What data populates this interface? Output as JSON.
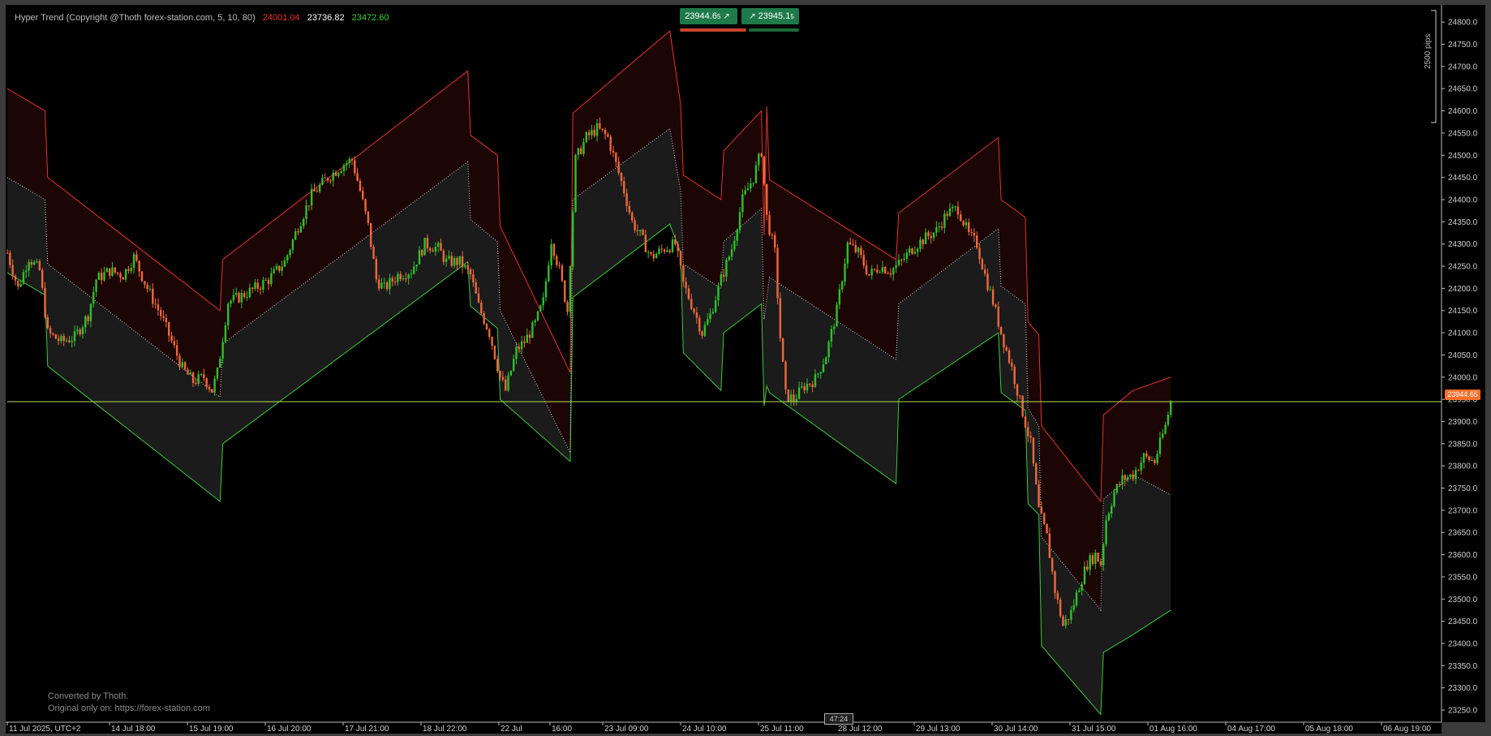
{
  "header": {
    "indicator_name": "Hyper Trend (Copyright @Thoth forex-station.com, 5, 10, 80)",
    "value_upper": "24001.04",
    "value_mid": "23736.82",
    "value_lower": "23472.60",
    "color_upper": "#e8342a",
    "color_mid": "#ffffff",
    "color_lower": "#39d42f"
  },
  "trade_panel": {
    "sell_price": "23944.6",
    "sell_suffix": "5",
    "buy_price": "23945.1",
    "buy_suffix": "5"
  },
  "watermark": {
    "line1": "Converted by Thoth.",
    "line2": "Original only on: https://forex-station.com"
  },
  "current_price_label": "23944.65",
  "bar_timer": "47:24",
  "pips_label": "2500 pips",
  "colors": {
    "background": "#000000",
    "upper_band": "#e2352a",
    "lower_band": "#3cc93a",
    "mid_dots": "#cccccc",
    "upper_fill": "#1c0505",
    "lower_fill": "#1b1b1b",
    "bull_candle": "#2fc12c",
    "bear_candle": "#f0683c",
    "price_line": "#b7e05a"
  },
  "chart_data": {
    "type": "candlestick with bands",
    "y_axis": {
      "range": [
        23225,
        24825
      ],
      "tick_labels": [
        "24800.0",
        "24750.0",
        "24700.0",
        "24650.0",
        "24600.0",
        "24550.0",
        "24500.0",
        "24450.0",
        "24400.0",
        "24350.0",
        "24300.0",
        "24250.0",
        "24200.0",
        "24150.0",
        "24100.0",
        "24050.0",
        "24000.0",
        "23950.0",
        "23900.0",
        "23850.0",
        "23800.0",
        "23750.0",
        "23700.0",
        "23650.0",
        "23600.0",
        "23550.0",
        "23500.0",
        "23450.0",
        "23400.0",
        "23350.0",
        "23300.0",
        "23250.0"
      ],
      "tick_values": [
        24800,
        24750,
        24700,
        24650,
        24600,
        24550,
        24500,
        24450,
        24400,
        24350,
        24300,
        24250,
        24200,
        24150,
        24100,
        24050,
        24000,
        23950,
        23900,
        23850,
        23800,
        23750,
        23700,
        23650,
        23600,
        23550,
        23500,
        23450,
        23400,
        23350,
        23300,
        23250
      ]
    },
    "x_axis": {
      "tick_labels": [
        "11 Jul 2025, UTC+2",
        "14 Jul 18:00",
        "15 Jul 19:00",
        "16 Jul 20:00",
        "17 Jul 21:00",
        "18 Jul 22:00",
        "22 Jul",
        "16:00",
        "23 Jul 09:00",
        "24 Jul 10:00",
        "25 Jul 11:00",
        "28 Jul 12:00",
        "29 Jul 13:00",
        "30 Jul 14:00",
        "31 Jul 15:00",
        "01 Aug 16:00",
        "04 Aug 17:00",
        "05 Aug 18:00",
        "06 Aug 19:00"
      ],
      "bar_positions": [
        0,
        27,
        53,
        79,
        106,
        133,
        159,
        183,
        209,
        235,
        262,
        288,
        315,
        341,
        368,
        394,
        421,
        445,
        471
      ],
      "total_bars": 500
    },
    "current_price": 23944.65,
    "upper_band": [
      [
        0,
        24650
      ],
      [
        14,
        24600
      ],
      [
        15,
        24450
      ],
      [
        79,
        24150
      ],
      [
        80,
        24265
      ],
      [
        171,
        24690
      ],
      [
        172,
        24545
      ],
      [
        182,
        24500
      ],
      [
        183,
        24340
      ],
      [
        209,
        24010
      ],
      [
        210,
        24595
      ],
      [
        246,
        24780
      ],
      [
        250,
        24615
      ],
      [
        251,
        24455
      ],
      [
        265,
        24400
      ],
      [
        266,
        24510
      ],
      [
        280,
        24600
      ],
      [
        281,
        24320
      ],
      [
        282,
        24610
      ],
      [
        283,
        24445
      ],
      [
        330,
        24265
      ],
      [
        331,
        24370
      ],
      [
        368,
        24540
      ],
      [
        369,
        24400
      ],
      [
        378,
        24360
      ],
      [
        379,
        24125
      ],
      [
        383,
        24095
      ],
      [
        384,
        23890
      ],
      [
        406,
        23720
      ],
      [
        407,
        23915
      ],
      [
        418,
        23970
      ],
      [
        432,
        24000
      ]
    ],
    "mid_band": [
      [
        0,
        24450
      ],
      [
        14,
        24400
      ],
      [
        15,
        24255
      ],
      [
        79,
        23955
      ],
      [
        80,
        24075
      ],
      [
        171,
        24485
      ],
      [
        172,
        24355
      ],
      [
        182,
        24305
      ],
      [
        183,
        24150
      ],
      [
        209,
        23830
      ],
      [
        210,
        24400
      ],
      [
        246,
        24560
      ],
      [
        250,
        24420
      ],
      [
        251,
        24255
      ],
      [
        265,
        24200
      ],
      [
        266,
        24305
      ],
      [
        280,
        24380
      ],
      [
        281,
        24130
      ],
      [
        282,
        24180
      ],
      [
        283,
        24225
      ],
      [
        330,
        24040
      ],
      [
        331,
        24165
      ],
      [
        368,
        24335
      ],
      [
        369,
        24205
      ],
      [
        378,
        24165
      ],
      [
        379,
        23930
      ],
      [
        383,
        23890
      ],
      [
        384,
        23640
      ],
      [
        406,
        23475
      ],
      [
        407,
        23725
      ],
      [
        418,
        23780
      ],
      [
        432,
        23735
      ]
    ],
    "lower_band": [
      [
        0,
        24235
      ],
      [
        14,
        24185
      ],
      [
        15,
        24025
      ],
      [
        79,
        23720
      ],
      [
        80,
        23850
      ],
      [
        171,
        24260
      ],
      [
        172,
        24160
      ],
      [
        182,
        24110
      ],
      [
        183,
        23950
      ],
      [
        209,
        23810
      ],
      [
        210,
        24180
      ],
      [
        246,
        24345
      ],
      [
        250,
        24280
      ],
      [
        251,
        24055
      ],
      [
        265,
        23970
      ],
      [
        266,
        24100
      ],
      [
        280,
        24165
      ],
      [
        281,
        23935
      ],
      [
        282,
        23980
      ],
      [
        283,
        23965
      ],
      [
        330,
        23760
      ],
      [
        331,
        23950
      ],
      [
        368,
        24100
      ],
      [
        369,
        23965
      ],
      [
        378,
        23925
      ],
      [
        379,
        23715
      ],
      [
        383,
        23690
      ],
      [
        384,
        23395
      ],
      [
        406,
        23240
      ],
      [
        407,
        23380
      ],
      [
        418,
        23420
      ],
      [
        432,
        23475
      ]
    ],
    "price_anchors": [
      [
        0,
        24280
      ],
      [
        4,
        24200
      ],
      [
        8,
        24270
      ],
      [
        12,
        24240
      ],
      [
        15,
        24100
      ],
      [
        20,
        24080
      ],
      [
        25,
        24090
      ],
      [
        30,
        24140
      ],
      [
        33,
        24220
      ],
      [
        38,
        24240
      ],
      [
        43,
        24230
      ],
      [
        47,
        24270
      ],
      [
        52,
        24200
      ],
      [
        57,
        24140
      ],
      [
        61,
        24080
      ],
      [
        65,
        24020
      ],
      [
        69,
        23990
      ],
      [
        73,
        24000
      ],
      [
        76,
        23970
      ],
      [
        78,
        24010
      ],
      [
        82,
        24170
      ],
      [
        86,
        24180
      ],
      [
        92,
        24200
      ],
      [
        97,
        24220
      ],
      [
        103,
        24260
      ],
      [
        108,
        24340
      ],
      [
        113,
        24410
      ],
      [
        119,
        24450
      ],
      [
        125,
        24480
      ],
      [
        128,
        24490
      ],
      [
        131,
        24420
      ],
      [
        134,
        24340
      ],
      [
        137,
        24220
      ],
      [
        140,
        24200
      ],
      [
        145,
        24230
      ],
      [
        150,
        24240
      ],
      [
        155,
        24300
      ],
      [
        160,
        24290
      ],
      [
        163,
        24260
      ],
      [
        168,
        24260
      ],
      [
        172,
        24230
      ],
      [
        175,
        24160
      ],
      [
        179,
        24100
      ],
      [
        183,
        24000
      ],
      [
        185,
        23970
      ],
      [
        189,
        24060
      ],
      [
        192,
        24080
      ],
      [
        196,
        24120
      ],
      [
        199,
        24170
      ],
      [
        202,
        24310
      ],
      [
        205,
        24240
      ],
      [
        208,
        24150
      ],
      [
        211,
        24490
      ],
      [
        215,
        24540
      ],
      [
        219,
        24560
      ],
      [
        223,
        24540
      ],
      [
        226,
        24480
      ],
      [
        229,
        24420
      ],
      [
        232,
        24350
      ],
      [
        235,
        24320
      ],
      [
        239,
        24270
      ],
      [
        244,
        24290
      ],
      [
        248,
        24300
      ],
      [
        251,
        24210
      ],
      [
        255,
        24150
      ],
      [
        258,
        24100
      ],
      [
        261,
        24140
      ],
      [
        265,
        24220
      ],
      [
        269,
        24290
      ],
      [
        273,
        24400
      ],
      [
        277,
        24450
      ],
      [
        280,
        24510
      ],
      [
        282,
        24360
      ],
      [
        285,
        24280
      ],
      [
        287,
        24090
      ],
      [
        289,
        23960
      ],
      [
        292,
        23950
      ],
      [
        296,
        23980
      ],
      [
        300,
        23995
      ],
      [
        304,
        24050
      ],
      [
        308,
        24150
      ],
      [
        312,
        24300
      ],
      [
        316,
        24280
      ],
      [
        320,
        24230
      ],
      [
        324,
        24250
      ],
      [
        328,
        24240
      ],
      [
        332,
        24260
      ],
      [
        336,
        24290
      ],
      [
        340,
        24310
      ],
      [
        345,
        24330
      ],
      [
        349,
        24370
      ],
      [
        353,
        24380
      ],
      [
        357,
        24320
      ],
      [
        360,
        24300
      ],
      [
        363,
        24230
      ],
      [
        366,
        24170
      ],
      [
        369,
        24100
      ],
      [
        373,
        24020
      ],
      [
        377,
        23920
      ],
      [
        380,
        23850
      ],
      [
        383,
        23700
      ],
      [
        386,
        23640
      ],
      [
        389,
        23520
      ],
      [
        392,
        23440
      ],
      [
        395,
        23470
      ],
      [
        398,
        23530
      ],
      [
        401,
        23580
      ],
      [
        404,
        23600
      ],
      [
        406,
        23580
      ],
      [
        408,
        23680
      ],
      [
        411,
        23740
      ],
      [
        414,
        23770
      ],
      [
        418,
        23780
      ],
      [
        422,
        23820
      ],
      [
        426,
        23810
      ],
      [
        430,
        23890
      ],
      [
        432,
        23944
      ]
    ]
  }
}
